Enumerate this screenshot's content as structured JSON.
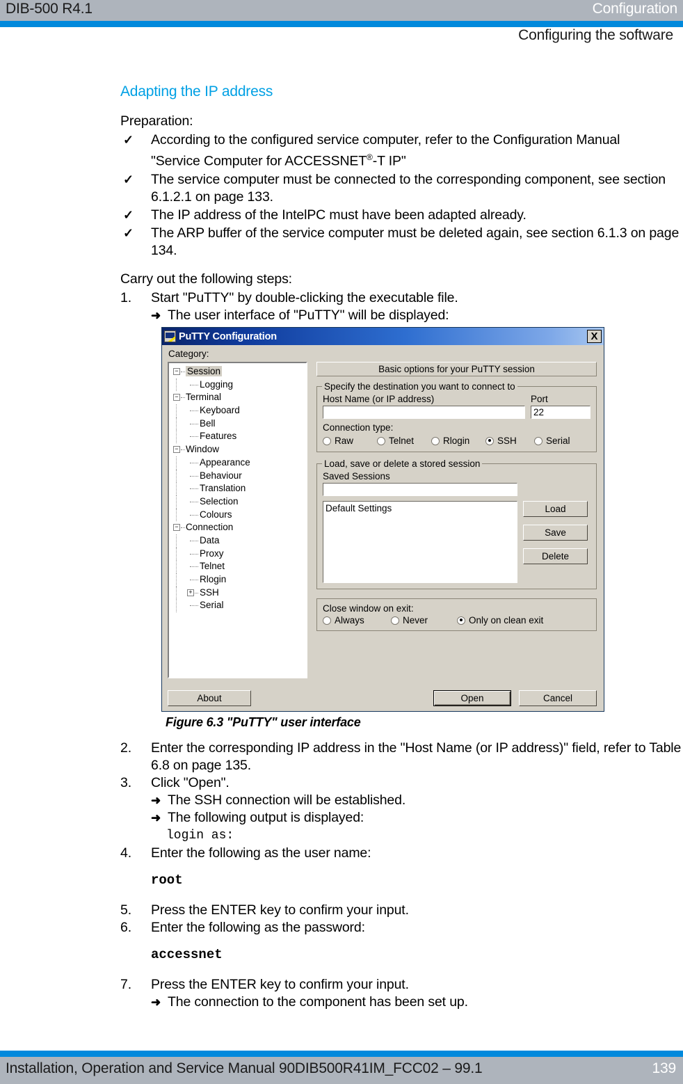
{
  "header": {
    "product": "DIB-500 R4.1",
    "chapter": "Configuration",
    "subtitle": "Configuring the software",
    "bar_gray": "#aeb4bc",
    "bar_blue": "#0089dc"
  },
  "content": {
    "section_title": "Adapting the IP address",
    "accent_color": "#00a0e4",
    "preparation_label": "Preparation:",
    "prerequisites": [
      {
        "tick": "✓",
        "line1": "According to the configured service computer, refer to the Configuration Manual",
        "line2_pre": "\"Service Computer for ACCESSNET",
        "line2_sup": "®",
        "line2_post": "-T IP\""
      },
      {
        "tick": "✓",
        "text": "The service computer must be connected to the corresponding component, see section 6.1.2.1 on page 133."
      },
      {
        "tick": "✓",
        "text": "The IP address of the IntelPC must have been adapted already."
      },
      {
        "tick": "✓",
        "text": "The ARP buffer of the service computer must be deleted again, see section 6.1.3 on page 134."
      }
    ],
    "steps_label": "Carry out the following steps:",
    "step1_num": "1.",
    "step1_text": "Start \"PuTTY\" by double-clicking the executable file.",
    "step1_arrow": "➜",
    "step1_result": "The user interface of \"PuTTY\" will be displayed:",
    "figure_caption": "Figure 6.3 \"PuTTY\" user interface",
    "step2_num": "2.",
    "step2_text": "Enter the corresponding IP address in the \"Host Name (or IP address)\" field, refer to Table 6.8 on page 135.",
    "step3_num": "3.",
    "step3_text": "Click \"Open\".",
    "step3_result1": "The SSH connection will be established.",
    "step3_result2": "The following output is displayed:",
    "step3_output": "login as:",
    "step4_num": "4.",
    "step4_text": "Enter the following as the user name:",
    "step4_value": "root",
    "step5_num": "5.",
    "step5_text": "Press the ENTER key to confirm your input.",
    "step6_num": "6.",
    "step6_text": "Enter the following as the password:",
    "step6_value": "accessnet",
    "step7_num": "7.",
    "step7_text": "Press the ENTER key to confirm your input.",
    "step7_result": "The connection to the component has been set up.",
    "arrow_glyph": "➜"
  },
  "putty": {
    "title": "PuTTY Configuration",
    "close_label": "X",
    "category_label": "Category:",
    "tree": [
      {
        "label": "Session",
        "level": 0,
        "expander": "−",
        "selected": true
      },
      {
        "label": "Logging",
        "level": 1,
        "expander": "",
        "selected": false
      },
      {
        "label": "Terminal",
        "level": 0,
        "expander": "−",
        "selected": false
      },
      {
        "label": "Keyboard",
        "level": 1,
        "expander": "",
        "selected": false
      },
      {
        "label": "Bell",
        "level": 1,
        "expander": "",
        "selected": false
      },
      {
        "label": "Features",
        "level": 1,
        "expander": "",
        "selected": false
      },
      {
        "label": "Window",
        "level": 0,
        "expander": "−",
        "selected": false
      },
      {
        "label": "Appearance",
        "level": 1,
        "expander": "",
        "selected": false
      },
      {
        "label": "Behaviour",
        "level": 1,
        "expander": "",
        "selected": false
      },
      {
        "label": "Translation",
        "level": 1,
        "expander": "",
        "selected": false
      },
      {
        "label": "Selection",
        "level": 1,
        "expander": "",
        "selected": false
      },
      {
        "label": "Colours",
        "level": 1,
        "expander": "",
        "selected": false
      },
      {
        "label": "Connection",
        "level": 0,
        "expander": "−",
        "selected": false
      },
      {
        "label": "Data",
        "level": 1,
        "expander": "",
        "selected": false
      },
      {
        "label": "Proxy",
        "level": 1,
        "expander": "",
        "selected": false
      },
      {
        "label": "Telnet",
        "level": 1,
        "expander": "",
        "selected": false
      },
      {
        "label": "Rlogin",
        "level": 1,
        "expander": "",
        "selected": false
      },
      {
        "label": "SSH",
        "level": 1,
        "expander": "+",
        "selected": false
      },
      {
        "label": "Serial",
        "level": 1,
        "expander": "",
        "selected": false
      }
    ],
    "banner": "Basic options for your PuTTY session",
    "destination": {
      "legend": "Specify the destination you want to connect to",
      "host_label": "Host Name (or IP address)",
      "host_value": "",
      "port_label": "Port",
      "port_value": "22",
      "conn_type_label": "Connection type:",
      "conn_types": [
        {
          "label": "Raw",
          "selected": false
        },
        {
          "label": "Telnet",
          "selected": false
        },
        {
          "label": "Rlogin",
          "selected": false
        },
        {
          "label": "SSH",
          "selected": true
        },
        {
          "label": "Serial",
          "selected": false
        }
      ]
    },
    "sessions": {
      "legend": "Load, save or delete a stored session",
      "saved_label": "Saved Sessions",
      "saved_value": "",
      "list_items": [
        "Default Settings"
      ],
      "load_label": "Load",
      "save_label": "Save",
      "delete_label": "Delete"
    },
    "close_on_exit": {
      "label": "Close window on exit:",
      "options": [
        {
          "label": "Always",
          "selected": false
        },
        {
          "label": "Never",
          "selected": false
        },
        {
          "label": "Only on clean exit",
          "selected": true
        }
      ]
    },
    "about_label": "About",
    "open_label": "Open",
    "cancel_label": "Cancel"
  },
  "footer": {
    "text": "Installation, Operation and Service Manual 90DIB500R41IM_FCC02 – 99.1",
    "page_number": "139"
  }
}
